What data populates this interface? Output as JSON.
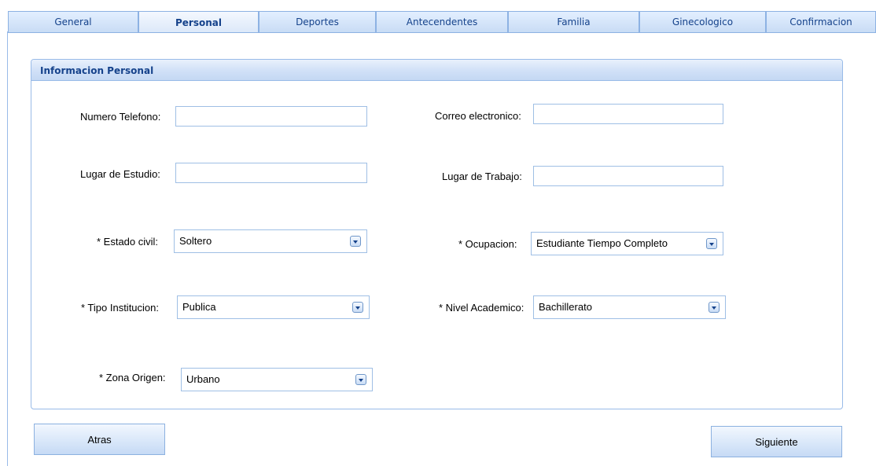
{
  "tabs": [
    {
      "label": "General"
    },
    {
      "label": "Personal",
      "active": true
    },
    {
      "label": "Deportes"
    },
    {
      "label": "Antecendentes"
    },
    {
      "label": "Familia"
    },
    {
      "label": "Ginecologico"
    },
    {
      "label": "Confirmacion"
    }
  ],
  "panel": {
    "title": "Informacion Personal"
  },
  "fields": {
    "numero_telefono": {
      "label": "Numero Telefono:",
      "value": ""
    },
    "correo": {
      "label": "Correo electronico:",
      "value": ""
    },
    "lugar_estudio": {
      "label": "Lugar de Estudio:",
      "value": ""
    },
    "lugar_trabajo": {
      "label": "Lugar de Trabajo:",
      "value": ""
    },
    "estado_civil": {
      "label": "* Estado civil:",
      "value": "Soltero"
    },
    "ocupacion": {
      "label": "* Ocupacion:",
      "value": "Estudiante Tiempo Completo"
    },
    "tipo_institucion": {
      "label": "* Tipo Institucion:",
      "value": "Publica"
    },
    "nivel_academico": {
      "label": "* Nivel Academico:",
      "value": "Bachillerato"
    },
    "zona_origen": {
      "label": "* Zona Origen:",
      "value": "Urbano"
    }
  },
  "buttons": {
    "back": "Atras",
    "next": "Siguiente"
  },
  "colors": {
    "accent": "#15428b",
    "border": "#99bbe8",
    "header_bg": "#d0e0f7"
  }
}
